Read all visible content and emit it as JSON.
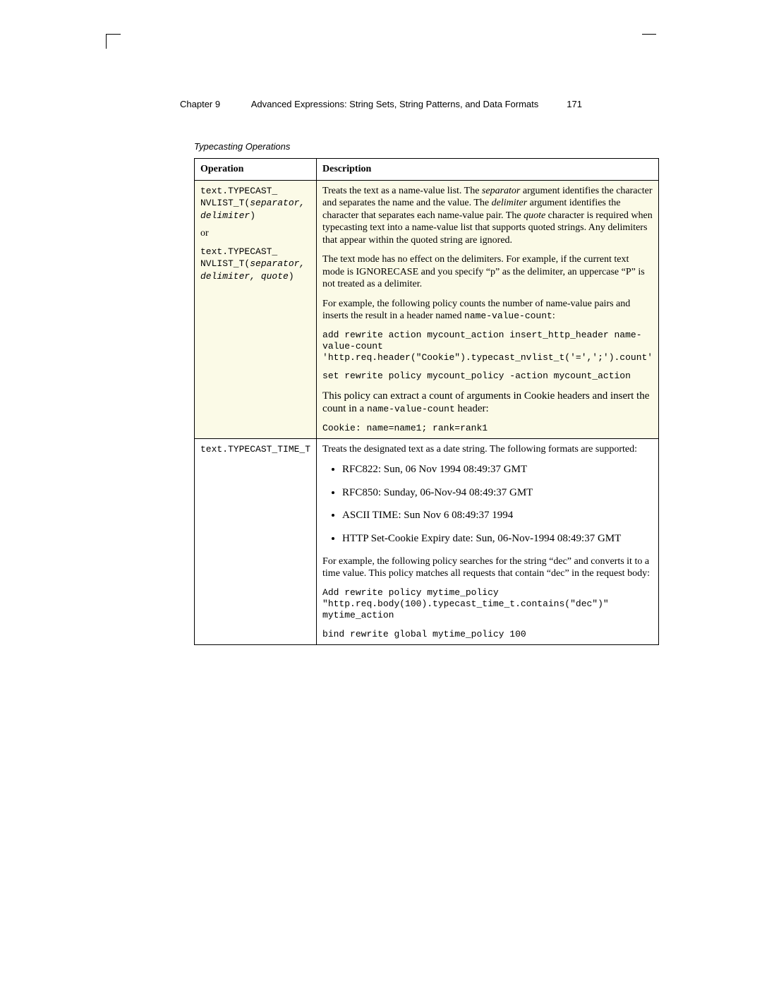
{
  "header": {
    "chapter": "Chapter 9",
    "title": "Advanced Expressions: String Sets, String Patterns, and Data Formats",
    "page": "171"
  },
  "caption": "Typecasting Operations",
  "columns": {
    "op": "Operation",
    "desc": "Description"
  },
  "row1": {
    "op": {
      "sig1a": "text.TYPECAST_",
      "sig1b": "NVLIST_T(",
      "sig1b_args": "separator, delimiter",
      "sig1c": ")",
      "or": "or",
      "sig2a": "text.TYPECAST_",
      "sig2b": "NVLIST_T(",
      "sig2b_args": "separator, delimiter, quote",
      "sig2c": ")"
    },
    "desc": {
      "p1a": "Treats the text as a name-value list. The ",
      "p1i1": "separator",
      "p1b": " argument identifies the character and separates the name and the value. The ",
      "p1i2": "delimiter",
      "p1c": " argument identifies the character that separates each name-value pair. The ",
      "p1i3": "quote",
      "p1d": " character is required when typecasting text into a name-value list that supports quoted strings. Any delimiters that appear within the quoted string are ignored.",
      "p2": "The text mode has no effect on the delimiters. For example, if the current text mode is IGNORECASE and you specify “p” as the delimiter, an uppercase “P” is not treated as a delimiter.",
      "p3a": "For example, the following policy counts the number of name-value pairs and inserts the result in a header named ",
      "p3code": "name-value-count",
      "p3b": ":",
      "code1": "add rewrite action mycount_action insert_http_header name-value-count 'http.req.header(\"Cookie\").typecast_nvlist_t('=',';').count'",
      "code2": "set rewrite policy mycount_policy -action mycount_action",
      "p4a": "This policy can extract a count of arguments in Cookie headers and insert the count in a ",
      "p4code": "name-value-count",
      "p4b": " header:",
      "code3": "Cookie: name=name1; rank=rank1"
    }
  },
  "row2": {
    "op": {
      "sig": "text.TYPECAST_TIME_T"
    },
    "desc": {
      "p1": "Treats the designated text as a date string. The following formats are supported:",
      "bullets": {
        "b1": "RFC822: Sun, 06 Nov 1994 08:49:37 GMT",
        "b2": "RFC850: Sunday, 06-Nov-94 08:49:37 GMT",
        "b3": "ASCII TIME: Sun Nov 6 08:49:37 1994",
        "b4": "HTTP Set-Cookie Expiry date: Sun, 06-Nov-1994 08:49:37 GMT"
      },
      "p2": "For example, the following policy searches for the string “dec” and converts it to a time value. This policy matches all requests that contain “dec” in the request body:",
      "code1": "Add rewrite policy mytime_policy \"http.req.body(100).typecast_time_t.contains(\"dec\")\" mytime_action",
      "code2": "bind rewrite global mytime_policy 100"
    }
  }
}
